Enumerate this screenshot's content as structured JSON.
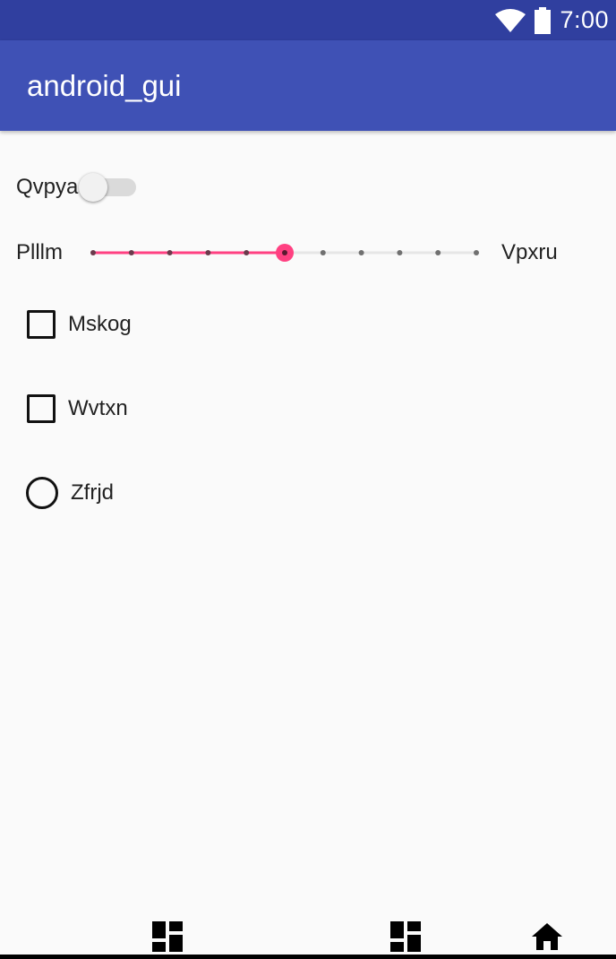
{
  "status_bar": {
    "time": "7:00",
    "icons": [
      "wifi-icon",
      "battery-icon"
    ]
  },
  "app_bar": {
    "title": "android_gui",
    "color": "#3f51b5",
    "status_color": "#303f9f"
  },
  "switch": {
    "label": "Qvpya",
    "checked": false
  },
  "slider": {
    "min_label": "Plllm",
    "max_label": "Vpxru",
    "steps": 10,
    "value": 5,
    "accent": "#ff4081"
  },
  "checkboxes": [
    {
      "label": "Mskog",
      "checked": false
    },
    {
      "label": "Wvtxn",
      "checked": false
    }
  ],
  "radio": {
    "label": "Zfrjd",
    "checked": false
  },
  "bottom_nav": {
    "icons": [
      "dashboard-icon",
      "dashboard-icon",
      "home-icon"
    ]
  }
}
